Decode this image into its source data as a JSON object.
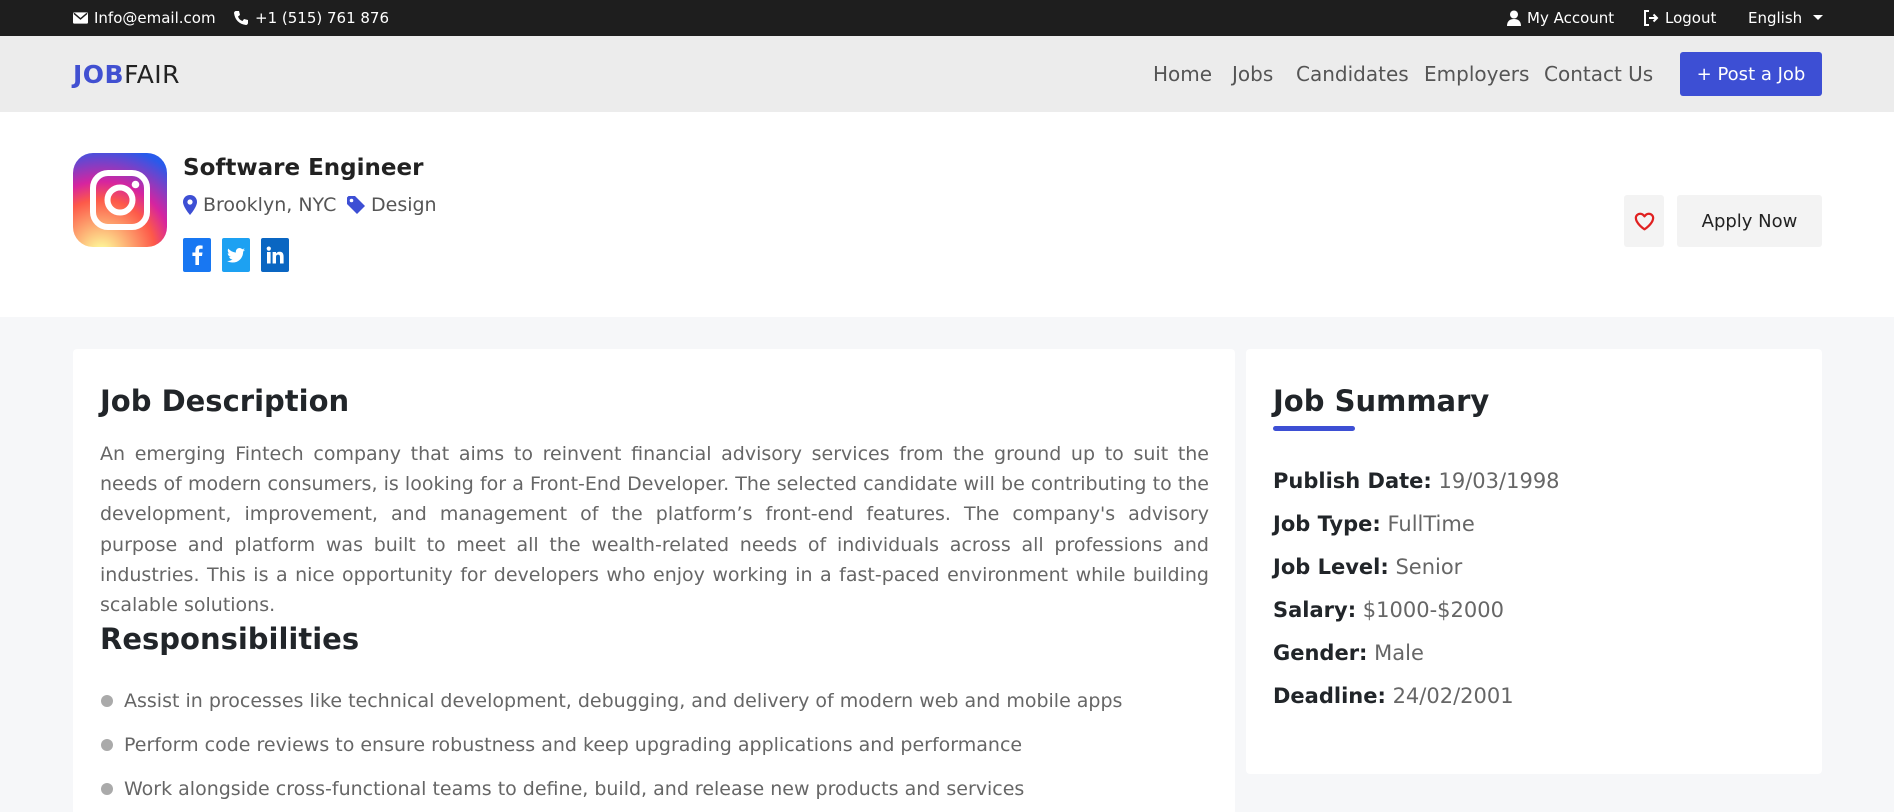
{
  "topbar": {
    "email": "Info@email.com",
    "phone": "+1 (515) 761 876",
    "account": "My Account",
    "logout": "Logout",
    "language": "English"
  },
  "navbar": {
    "logo_bold": "JOB",
    "logo_rest": "FAIR",
    "links": [
      "Home",
      "Jobs",
      "Candidates",
      "Employers",
      "Contact Us"
    ],
    "post_job": "+ Post a Job"
  },
  "job": {
    "title": "Software Engineer",
    "location": "Brooklyn, NYC",
    "category": "Design",
    "social": [
      "facebook",
      "twitter",
      "linkedin"
    ],
    "apply": "Apply Now"
  },
  "description": {
    "heading": "Job Description",
    "text": "An emerging Fintech company that aims to reinvent financial advisory services from the ground up to suit the needs of modern consumers, is looking for a Front-End Developer. The selected candidate will be contributing to the development, improvement, and management of the platform’s front-end features. The company's advisory purpose and platform was built to meet all the wealth-related needs of individuals across all professions and industries. This is a nice opportunity for developers who enjoy working in a fast-paced environment while building scalable solutions.",
    "responsibilities_heading": "Responsibilities",
    "responsibilities": [
      "Assist in processes like technical development, debugging, and delivery of modern web and mobile apps",
      "Perform code reviews to ensure robustness and keep upgrading applications and performance",
      "Work alongside cross-functional teams to define, build, and release new products and services"
    ]
  },
  "summary": {
    "heading": "Job Summary",
    "rows": [
      {
        "label": "Publish Date:",
        "value": "19/03/1998"
      },
      {
        "label": "Job Type:",
        "value": "FullTime"
      },
      {
        "label": "Job Level:",
        "value": "Senior"
      },
      {
        "label": "Salary:",
        "value": "$1000-$2000"
      },
      {
        "label": "Gender:",
        "value": "Male"
      },
      {
        "label": "Deadline:",
        "value": "24/02/2001"
      }
    ]
  },
  "colors": {
    "accent": "#3d4fd4",
    "topbar": "#1e1e1e",
    "facebook": "#1877f2",
    "twitter": "#1da1f2",
    "linkedin": "#0a66c2",
    "heart": "#e02020"
  },
  "icons": [
    "envelope-icon",
    "phone-icon",
    "user-icon",
    "logout-icon",
    "caret-down-icon",
    "instagram-icon",
    "map-marker-icon",
    "tag-icon",
    "facebook-icon",
    "twitter-icon",
    "linkedin-icon",
    "heart-icon"
  ]
}
